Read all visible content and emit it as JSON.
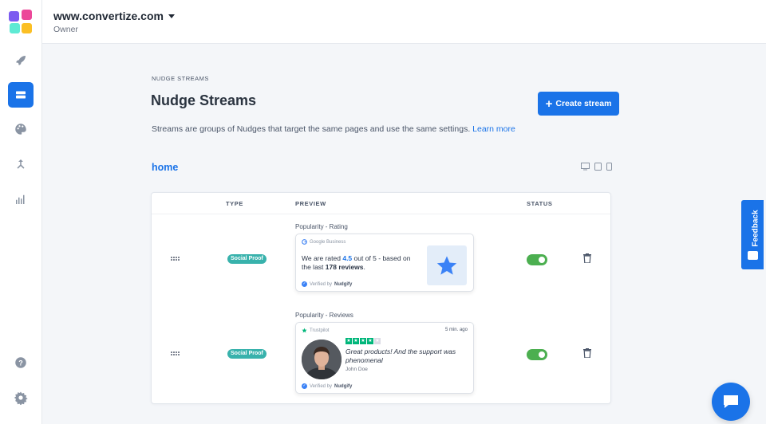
{
  "colors": {
    "accent": "#1a73e8",
    "badge": "#38b2ac",
    "toggle_on": "#4caf50",
    "trustpilot": "#00b67a"
  },
  "sidebar": {
    "items": [
      {
        "name": "rocket-icon"
      },
      {
        "name": "streams-icon",
        "active": true
      },
      {
        "name": "palette-icon"
      },
      {
        "name": "merge-icon"
      },
      {
        "name": "analytics-icon"
      },
      {
        "name": "help-icon"
      },
      {
        "name": "settings-icon"
      }
    ]
  },
  "topbar": {
    "site": "www.convertize.com",
    "role": "Owner"
  },
  "main": {
    "eyebrow": "NUDGE STREAMS",
    "title": "Nudge Streams",
    "create_label": "Create stream",
    "description": "Streams are groups of Nudges that target the same pages and use the same settings.",
    "learn_more": "Learn more",
    "stream_name": "home"
  },
  "table": {
    "headers": {
      "type": "TYPE",
      "preview": "PREVIEW",
      "status": "STATUS"
    },
    "rows": [
      {
        "type": "Social Proof",
        "preview_label": "Popularity - Rating",
        "source": "Google Business",
        "text_before": "We are rated ",
        "rating": "4.5",
        "text_mid": " out of 5 - based on the last ",
        "reviews": "178 reviews",
        "text_end": ".",
        "verified_prefix": "Verified by",
        "verified_brand": "Nudgify",
        "status_on": true
      },
      {
        "type": "Social Proof",
        "preview_label": "Popularity - Reviews",
        "source": "Trustpilot",
        "time": "5 min. ago",
        "quote": "Great products! And the support was phenomenal",
        "author": "John Doe",
        "stars": 4,
        "verified_prefix": "Verified by",
        "verified_brand": "Nudgify",
        "status_on": true
      }
    ]
  },
  "feedback": {
    "label": "Feedback"
  }
}
